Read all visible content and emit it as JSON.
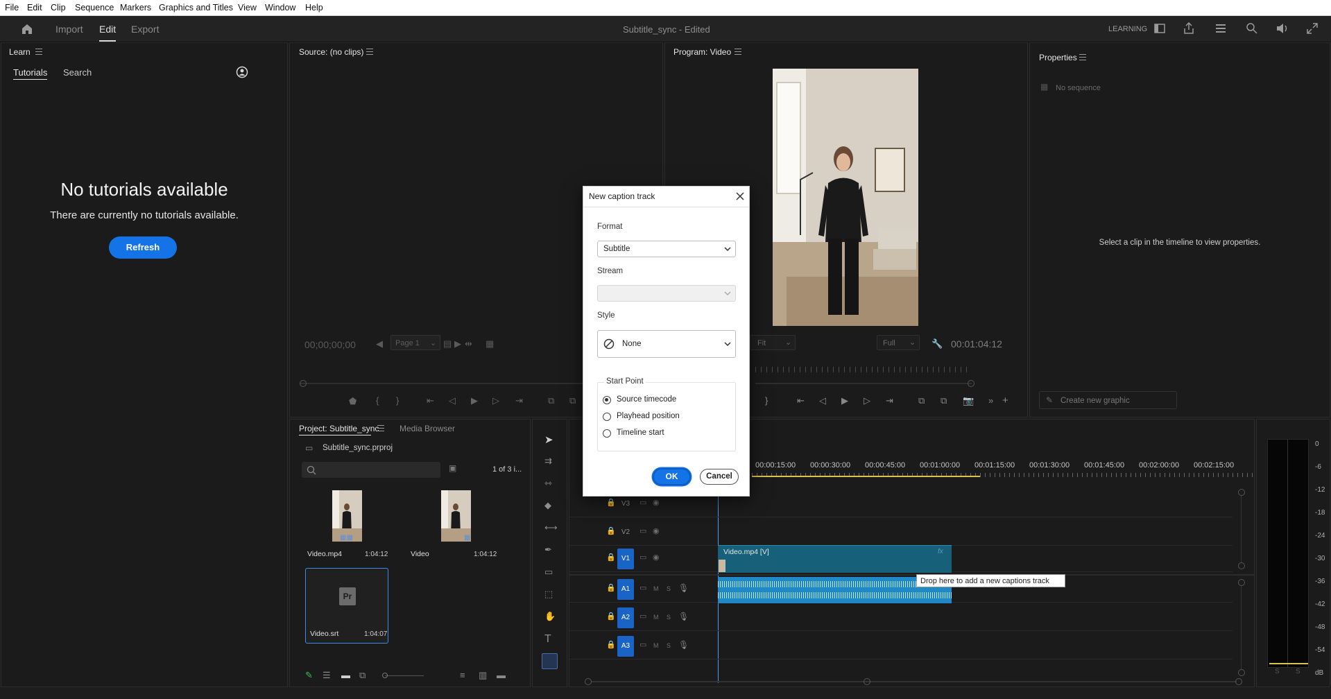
{
  "menubar": [
    "File",
    "Edit",
    "Clip",
    "Sequence",
    "Markers",
    "Graphics and Titles",
    "View",
    "Window",
    "Help"
  ],
  "header": {
    "tabs": [
      "Import",
      "Edit",
      "Export"
    ],
    "active_tab": "Edit",
    "project_title": "Subtitle_sync - Edited",
    "workspace": "LEARNING"
  },
  "learn_panel": {
    "title": "Learn",
    "tabs": [
      "Tutorials",
      "Search"
    ],
    "empty_title": "No tutorials available",
    "empty_message": "There are currently no tutorials available.",
    "refresh_label": "Refresh"
  },
  "source_panel": {
    "title": "Source: (no clips)",
    "timecode": "00;00;00;00",
    "page_select": "Page 1"
  },
  "program_panel": {
    "title": "Program: Video",
    "fit_select": "Fit",
    "quality_select": "Full",
    "timecode": "00:01:04:12"
  },
  "properties_panel": {
    "title": "Properties",
    "no_sequence": "No sequence",
    "hint": "Select a clip in the timeline to view properties.",
    "create_graphic_label": "Create new graphic"
  },
  "project_panel": {
    "title": "Project: Subtitle_sync",
    "media_browser_tab": "Media Browser",
    "project_file": "Subtitle_sync.prproj",
    "item_count": "1 of 3 i...",
    "search_placeholder": "",
    "items": [
      {
        "name": "Video.mp4",
        "duration": "1:04:12"
      },
      {
        "name": "Video",
        "duration": "1:04:12"
      },
      {
        "name": "Video.srt",
        "duration": "1:04:07"
      }
    ],
    "srt_glyph": "Pr"
  },
  "timeline": {
    "ruler": [
      "00:00:15:00",
      "00:00:30:00",
      "00:00:45:00",
      "00:01:00:00",
      "00:01:15:00",
      "00:01:30:00",
      "00:01:45:00",
      "00:02:00:00",
      "00:02:15:00"
    ],
    "video_tracks": [
      "V3",
      "V2",
      "V1"
    ],
    "audio_tracks": [
      "A1",
      "A2",
      "A3"
    ],
    "track_m": "M",
    "track_s": "S",
    "clip_label": "Video.mp4 [V]",
    "clip_fx": "fx",
    "drop_tooltip": "Drop here to add a new captions track"
  },
  "audio_meter": {
    "db_labels": [
      "0",
      "-6",
      "-12",
      "-18",
      "-24",
      "-30",
      "-36",
      "-42",
      "-48",
      "-54",
      "dB"
    ],
    "solo_labels": [
      "S",
      "S"
    ]
  },
  "dialog": {
    "title": "New caption track",
    "format_label": "Format",
    "format_value": "Subtitle",
    "stream_label": "Stream",
    "stream_value": "",
    "style_label": "Style",
    "style_value": "None",
    "start_point_label": "Start Point",
    "start_options": [
      "Source timecode",
      "Playhead position",
      "Timeline start"
    ],
    "selected_start": "Source timecode",
    "ok_label": "OK",
    "cancel_label": "Cancel"
  },
  "colors": {
    "accent_blue": "#1473e6",
    "track_blue": "#1a64c8",
    "clip_teal": "#17607a",
    "background": "#1b1b1b"
  }
}
